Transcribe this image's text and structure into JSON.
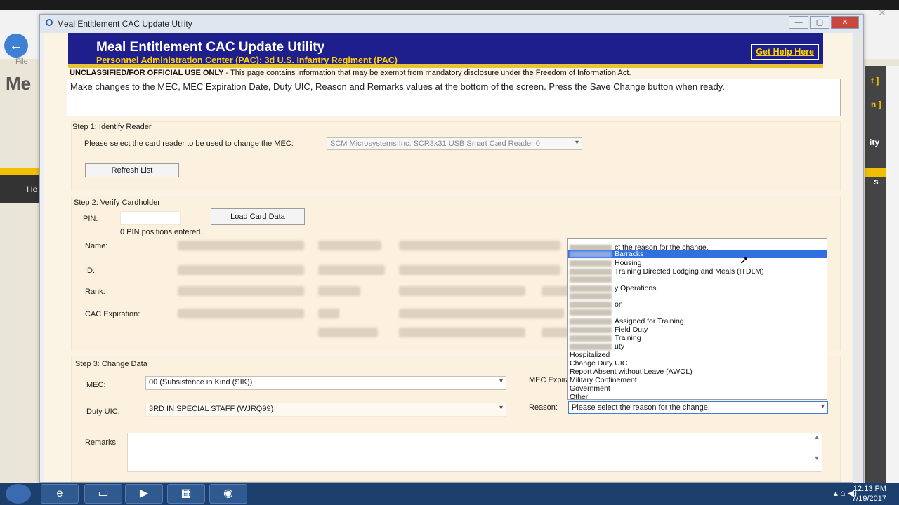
{
  "browser": {
    "file_menu": "File",
    "brand_fragment": "Me",
    "nav_fragment": "Ho",
    "right_fragments": [
      "t ]",
      "n ]",
      "ity",
      "s"
    ]
  },
  "window": {
    "title": "Meal Entitlement CAC Update Utility"
  },
  "banner": {
    "title": "Meal Entitlement CAC Update Utility",
    "subtitle": "Personnel Administration Center (PAC):  3d U.S. Infantry Regiment (PAC)",
    "help_link": "Get Help Here"
  },
  "classification": {
    "label": "UNCLASSIFIED/FOR OFFICIAL USE ONLY",
    "text": " - This page contains information that may be exempt from mandatory disclosure under the Freedom of Information Act."
  },
  "instructions": "Make changes to the MEC, MEC Expiration Date, Duty UIC, Reason and Remarks values at the bottom of the screen.  Press the Save Change button when ready.",
  "step1": {
    "label": "Step 1:  Identify Reader",
    "prompt": "Please select the card reader to be used to change the MEC:",
    "reader": "SCM Microsystems Inc. SCR3x31 USB Smart Card Reader 0",
    "refresh_button": "Refresh List"
  },
  "step2": {
    "label": "Step 2:  Verify Cardholder",
    "pin_label": "PIN:",
    "pin_status": "0 PIN positions entered.",
    "load_button": "Load Card Data",
    "name_label": "Name:",
    "id_label": "ID:",
    "rank_label": "Rank:",
    "cac_label": "CAC Expiration:"
  },
  "step3": {
    "label": "Step 3:  Change Data",
    "mec_label": "MEC:",
    "mec_value": "00  (Subsistence in Kind (SIK))",
    "mec_exp_label": "MEC Expira",
    "duty_label": "Duty UIC:",
    "duty_value": "3RD IN SPECIAL STAFF  (WJRQ99)",
    "reason_label": "Reason:",
    "reason_value": "Please select the reason for the change.",
    "remarks_label": "Remarks:"
  },
  "reason_options": [
    {
      "text": "ct the reason for the change.",
      "blurred_prefix": true
    },
    {
      "text": "Barracks",
      "blurred_prefix": true,
      "selected": true
    },
    {
      "text": "Housing",
      "blurred_prefix": true
    },
    {
      "text": "Training Directed Lodging and Meals (ITDLM)",
      "blurred_prefix": true
    },
    {
      "text": "",
      "blurred_prefix": true
    },
    {
      "text": "y Operations",
      "blurred_prefix": true
    },
    {
      "text": "",
      "blurred_prefix": true
    },
    {
      "text": "on",
      "blurred_prefix": true
    },
    {
      "text": "",
      "blurred_prefix": true
    },
    {
      "text": "Assigned for Training",
      "blurred_prefix": true
    },
    {
      "text": "Field Duty",
      "blurred_prefix": true
    },
    {
      "text": "Training",
      "blurred_prefix": true
    },
    {
      "text": "uty",
      "blurred_prefix": true
    },
    {
      "text": "Hospitalized",
      "blurred_prefix": false
    },
    {
      "text": "Change Duty UIC",
      "blurred_prefix": false
    },
    {
      "text": "Report Absent without Leave (AWOL)",
      "blurred_prefix": false
    },
    {
      "text": "Military Confinement",
      "blurred_prefix": false
    },
    {
      "text": "Government",
      "blurred_prefix": false
    },
    {
      "text": "Other",
      "blurred_prefix": false
    }
  ],
  "taskbar": {
    "time": "12:13 PM",
    "date": "7/19/2017"
  },
  "colors": {
    "banner": "#1e1e8c",
    "banner_text_accent": "#ffd200",
    "page_bg": "#fbf3e3",
    "selection": "#3070e0"
  }
}
